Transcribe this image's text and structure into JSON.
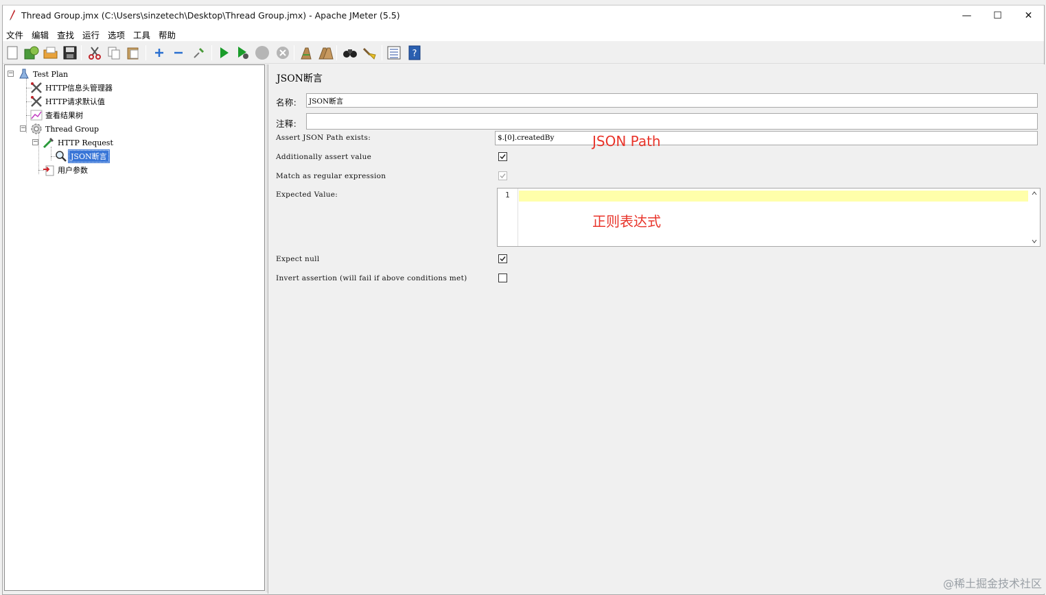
{
  "window": {
    "title": "Thread Group.jmx (C:\\Users\\sinzetech\\Desktop\\Thread Group.jmx) - Apache JMeter (5.5)",
    "controls": {
      "minimize": "—",
      "maximize": "☐",
      "close": "✕"
    }
  },
  "menu": [
    "文件",
    "编辑",
    "查找",
    "运行",
    "选项",
    "工具",
    "帮助"
  ],
  "toolbar": [
    "new-icon",
    "templates-icon",
    "open-icon",
    "save-icon",
    "cut-icon",
    "copy-icon",
    "paste-icon",
    "expand-icon",
    "collapse-icon",
    "toggle-icon",
    "start-icon",
    "start-no-pause-icon",
    "stop-icon",
    "shutdown-icon",
    "clear-icon",
    "clear-all-icon",
    "search-icon",
    "reset-search-icon",
    "function-helper-icon",
    "help-icon"
  ],
  "tree": {
    "items": [
      {
        "label": "Test Plan"
      },
      {
        "label": "HTTP信息头管理器"
      },
      {
        "label": "HTTP请求默认值"
      },
      {
        "label": "查看结果树"
      },
      {
        "label": "Thread Group"
      },
      {
        "label": "HTTP Request"
      },
      {
        "label": "JSON断言"
      },
      {
        "label": "用户参数"
      }
    ]
  },
  "editor": {
    "title": "JSON断言",
    "name_label": "名称:",
    "name_value": "JSON断言",
    "comment_label": "注释:",
    "comment_value": "",
    "path_label": "Assert JSON Path exists:",
    "path_value": "$.[0].createdBy",
    "assert_value_label": "Additionally assert value",
    "assert_value_checked": true,
    "regex_label": "Match as regular expression",
    "regex_checked": true,
    "expected_label": "Expected Value:",
    "expected_line_number": "1",
    "expect_null_label": "Expect null",
    "expect_null_checked": true,
    "invert_label": "Invert assertion (will fail if above conditions met)",
    "invert_checked": false
  },
  "annotations": {
    "json_path": "JSON Path",
    "regex": "正则表达式"
  },
  "watermark": "@稀土掘金技术社区",
  "colors": {
    "selection": "#3875d7",
    "annotation": "#e8342a",
    "line_highlight": "#ffffaa",
    "start_green": "#1a9c2a"
  }
}
